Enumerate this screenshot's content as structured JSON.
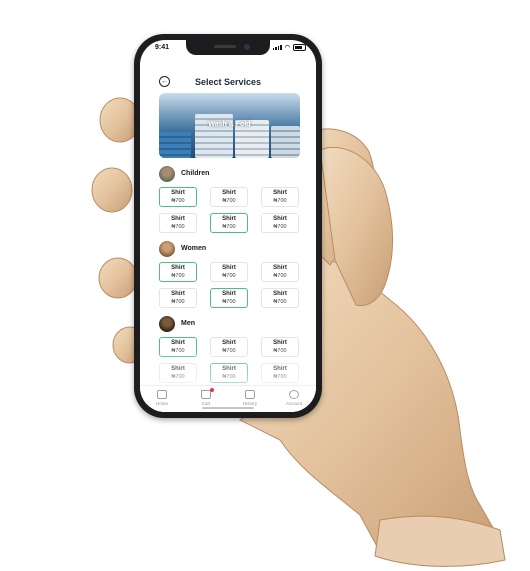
{
  "status_bar": {
    "time": "9:41"
  },
  "header": {
    "title": "Select Services",
    "back_icon": "arrow-left-icon"
  },
  "banner": {
    "caption": "Wash & Fold"
  },
  "sections": [
    {
      "label": "Children",
      "avatar": "child-avatar",
      "items": [
        {
          "name": "Shirt",
          "price": "₦700",
          "selected": true
        },
        {
          "name": "Shirt",
          "price": "₦700",
          "selected": false
        },
        {
          "name": "Shirt",
          "price": "₦700",
          "selected": false
        },
        {
          "name": "Shirt",
          "price": "₦700",
          "selected": false
        },
        {
          "name": "Shirt",
          "price": "₦700",
          "selected": true
        },
        {
          "name": "Shirt",
          "price": "₦700",
          "selected": false
        }
      ]
    },
    {
      "label": "Women",
      "avatar": "women-avatar",
      "items": [
        {
          "name": "Shirt",
          "price": "₦700",
          "selected": true
        },
        {
          "name": "Shirt",
          "price": "₦700",
          "selected": false
        },
        {
          "name": "Shirt",
          "price": "₦700",
          "selected": false
        },
        {
          "name": "Shirt",
          "price": "₦700",
          "selected": false
        },
        {
          "name": "Shirt",
          "price": "₦700",
          "selected": true
        },
        {
          "name": "Shirt",
          "price": "₦700",
          "selected": false
        }
      ]
    },
    {
      "label": "Men",
      "avatar": "men-avatar",
      "items": [
        {
          "name": "Shirt",
          "price": "₦700",
          "selected": true
        },
        {
          "name": "Shirt",
          "price": "₦700",
          "selected": false
        },
        {
          "name": "Shirt",
          "price": "₦700",
          "selected": false
        },
        {
          "name": "Shirt",
          "price": "₦700",
          "selected": false
        },
        {
          "name": "Shirt",
          "price": "₦700",
          "selected": true
        },
        {
          "name": "Shirt",
          "price": "₦700",
          "selected": false
        }
      ]
    }
  ],
  "tabbar": [
    {
      "label": "Home",
      "icon": "home-icon"
    },
    {
      "label": "Cart",
      "icon": "cart-icon",
      "badge": true
    },
    {
      "label": "History",
      "icon": "history-icon"
    },
    {
      "label": "Account",
      "icon": "account-icon"
    }
  ],
  "colors": {
    "selected_border": "#4bbf87",
    "title": "#1e2c3a",
    "cart_badge": "#e23b3b",
    "phone_frame": "#1d1d1f",
    "wood": "#e7c8a4"
  }
}
